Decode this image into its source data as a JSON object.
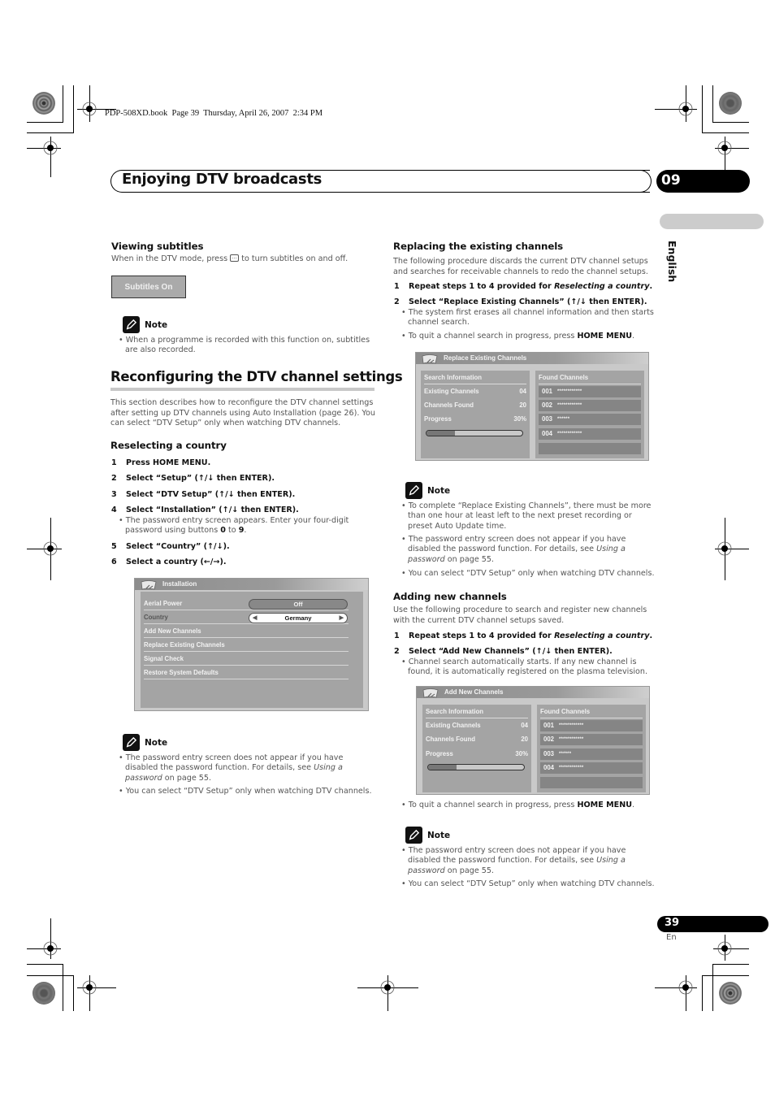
{
  "book_header": "PDP-508XD.book  Page 39  Thursday, April 26, 2007  2:34 PM",
  "chapter": {
    "title": "Enjoying DTV broadcasts",
    "number": "09"
  },
  "language_tab": "English",
  "left": {
    "viewing_subtitles": {
      "heading": "Viewing subtitles",
      "text_before": "When in the DTV mode, press",
      "icon": "subtitle-button-icon",
      "text_after": "to turn subtitles on and off.",
      "osd_label": "Subtitles On",
      "note_label": "Note",
      "note_bullets": [
        "When a programme is recorded with this function on, subtitles are also recorded."
      ]
    },
    "reconfiguring": {
      "heading": "Reconfiguring the DTV channel settings",
      "intro": "This section describes how to reconfigure the DTV channel settings after setting up DTV channels using Auto Installation (page 26). You can select “DTV Setup” only when watching DTV channels.",
      "reselecting": {
        "heading": "Reselecting a country",
        "steps": [
          {
            "n": "1",
            "text": "Press HOME MENU."
          },
          {
            "n": "2",
            "text": "Select “Setup” (↑/↓ then ENTER)."
          },
          {
            "n": "3",
            "text": "Select “DTV Setup” (↑/↓ then ENTER)."
          },
          {
            "n": "4",
            "text": "Select “Installation” (↑/↓ then ENTER)."
          },
          {
            "n": "5",
            "text": "Select  “Country” (↑/↓)."
          },
          {
            "n": "6",
            "text": "Select a country (←/→)."
          }
        ],
        "step4_bullet_pre": "The password entry screen appears. Enter your four-digit password using buttons ",
        "step4_bullet_b1": "0",
        "step4_bullet_mid": " to ",
        "step4_bullet_b2": "9",
        "step4_bullet_post": "."
      },
      "installation_screen": {
        "title": "Installation",
        "rows": [
          {
            "label": "Aerial Power",
            "value": "Off"
          },
          {
            "label": "Country",
            "value": "Germany"
          },
          {
            "label": "Add New Channels"
          },
          {
            "label": "Replace Existing Channels"
          },
          {
            "label": "Signal Check"
          },
          {
            "label": "Restore System Defaults"
          }
        ]
      },
      "note_label": "Note",
      "note_bullet1_pre": "The password entry screen does not appear if you have disabled the password function. For details, see ",
      "note_bullet1_em": "Using a password",
      "note_bullet1_post": " on page 55.",
      "note_bullet2": "You can select “DTV Setup” only when watching DTV channels."
    }
  },
  "right": {
    "replacing": {
      "heading": "Replacing the existing channels",
      "intro": "The following procedure discards the current DTV channel setups and searches for receivable channels to redo the channel setups.",
      "step1_pre": "Repeat steps 1 to 4 provided for ",
      "step1_em": "Reselecting a country",
      "step1_post": ".",
      "step2": "Select “Replace Existing Channels” (↑/↓ then ENTER).",
      "bullet1": "The system first erases all channel information and then starts channel search.",
      "bullet2_pre": "To quit a channel search in progress, press ",
      "bullet2_b": "HOME MENU",
      "bullet2_post": ".",
      "screen": {
        "title": "Replace Existing Channels",
        "search_info_label": "Search Information",
        "existing_label": "Existing Channels",
        "existing_value": "04",
        "found_label": "Channels Found",
        "found_value": "20",
        "progress_label": "Progress",
        "progress_value": "30%",
        "progress_fraction": 0.3,
        "found_channels_label": "Found Channels",
        "channels": [
          {
            "num": "001",
            "name": "************"
          },
          {
            "num": "002",
            "name": "************"
          },
          {
            "num": "003",
            "name": "******"
          },
          {
            "num": "004",
            "name": "************"
          }
        ]
      },
      "note_label": "Note",
      "note_b1": "To complete “Replace Existing Channels”, there must be more than one hour at least left to the next preset recording or preset Auto Update time.",
      "note_b2_pre": "The password entry screen does not appear if you have disabled the password function. For details, see ",
      "note_b2_em": "Using a password",
      "note_b2_post": " on page 55.",
      "note_b3": "You can select “DTV Setup” only when watching DTV channels."
    },
    "adding": {
      "heading": "Adding new channels",
      "intro": "Use the following procedure to search and register new channels with the current DTV channel setups saved.",
      "step1_pre": "Repeat steps 1 to 4 provided for ",
      "step1_em": "Reselecting a country",
      "step1_post": ".",
      "step2": "Select  “Add New Channels” (↑/↓ then ENTER).",
      "bullet1": "Channel search automatically starts. If any new channel is found, it is automatically registered on the plasma television.",
      "screen": {
        "title": "Add New Channels",
        "search_info_label": "Search Information",
        "existing_label": "Existing Channels",
        "existing_value": "04",
        "found_label": "Channels Found",
        "found_value": "20",
        "progress_label": "Progress",
        "progress_value": "30%",
        "progress_fraction": 0.3,
        "found_channels_label": "Found Channels",
        "channels": [
          {
            "num": "001",
            "name": "************"
          },
          {
            "num": "002",
            "name": "************"
          },
          {
            "num": "003",
            "name": "******"
          },
          {
            "num": "004",
            "name": "************"
          }
        ]
      },
      "quit_pre": "To quit a channel search in progress, press ",
      "quit_b": "HOME MENU",
      "quit_post": ".",
      "note_label": "Note",
      "note_b1_pre": "The password entry screen does not appear if you have disabled the password function. For details, see ",
      "note_b1_em": "Using a password",
      "note_b1_post": " on page 55.",
      "note_b2": "You can select “DTV Setup” only when watching DTV channels."
    }
  },
  "footer": {
    "page_number": "39",
    "lang_code": "En"
  }
}
